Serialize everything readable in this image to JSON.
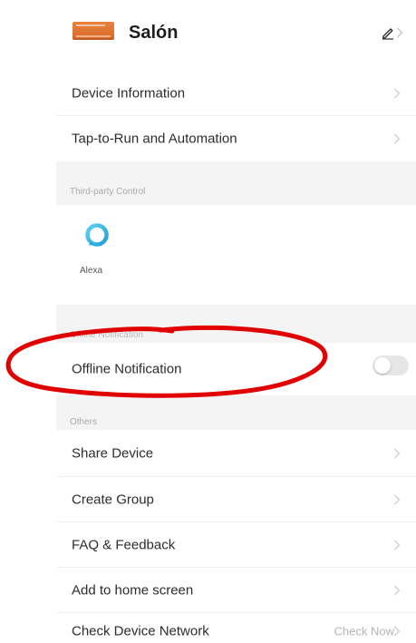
{
  "header": {
    "device_name": "Salón",
    "thumbnail_icon": "device-thumbnail-icon",
    "edit_icon": "pencil-icon"
  },
  "rows": {
    "device_information": "Device Information",
    "tap_to_run": "Tap-to-Run and Automation",
    "offline_notification": "Offline Notification",
    "share_device": "Share Device",
    "create_group": "Create Group",
    "faq_feedback": "FAQ & Feedback",
    "add_home_screen": "Add to home screen",
    "check_network": "Check Device Network",
    "check_network_value": "Check Now"
  },
  "sections": {
    "third_party": "Third-party Control",
    "offline_notice": "Offline Notification",
    "others": "Others"
  },
  "third_party": {
    "alexa": "Alexa"
  },
  "toggle": {
    "offline_notification_on": false
  },
  "colors": {
    "accent_orange": "#d9692a",
    "alexa_blue": "#31c4f3",
    "annotation_red": "#e00000",
    "section_background": "#f4f4f5"
  },
  "icons": {
    "chevron": "chevron-right-icon",
    "alexa": "alexa-icon"
  }
}
